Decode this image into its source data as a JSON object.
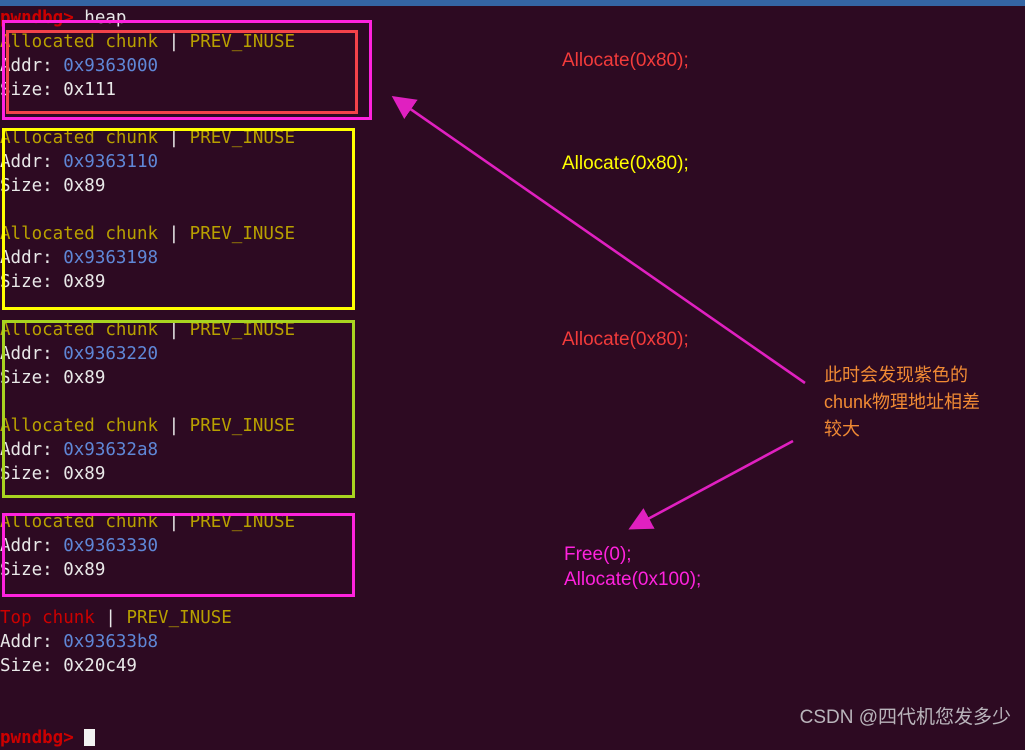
{
  "window": {
    "background_color": "#2d0a22",
    "titlebar_color": "#3465a4"
  },
  "terminal": {
    "prompt_top": "pwndbg>",
    "command_top": " heap",
    "prompt_bottom": "pwndbg>",
    "labels": {
      "allocated_chunk": "Allocated chunk",
      "top_chunk": "Top chunk",
      "separator": " | ",
      "prev_inuse": "PREV_INUSE",
      "addr_label": "Addr: ",
      "size_label": "Size: "
    },
    "chunks": [
      {
        "kind": "Allocated chunk",
        "flags": "PREV_INUSE",
        "addr": "0x9363000",
        "size": "0x111"
      },
      {
        "kind": "Allocated chunk",
        "flags": "PREV_INUSE",
        "addr": "0x9363110",
        "size": "0x89"
      },
      {
        "kind": "Allocated chunk",
        "flags": "PREV_INUSE",
        "addr": "0x9363198",
        "size": "0x89"
      },
      {
        "kind": "Allocated chunk",
        "flags": "PREV_INUSE",
        "addr": "0x9363220",
        "size": "0x89"
      },
      {
        "kind": "Allocated chunk",
        "flags": "PREV_INUSE",
        "addr": "0x93632a8",
        "size": "0x89"
      },
      {
        "kind": "Allocated chunk",
        "flags": "PREV_INUSE",
        "addr": "0x9363330",
        "size": "0x89"
      },
      {
        "kind": "Top chunk",
        "flags": "PREV_INUSE",
        "addr": "0x93633b8",
        "size": "0x20c49"
      }
    ]
  },
  "highlights": [
    {
      "name": "chunk-group-1-outer",
      "color": "#ff22dd"
    },
    {
      "name": "chunk-group-1-inner",
      "color": "#f4424a"
    },
    {
      "name": "chunk-group-2",
      "color": "#ffff00"
    },
    {
      "name": "chunk-group-3",
      "color": "#a8d420"
    },
    {
      "name": "chunk-group-4",
      "color": "#ff22dd"
    }
  ],
  "annotations": {
    "allocate_1": "Allocate(0x80);",
    "allocate_2": "Allocate(0x80);",
    "allocate_3": "Allocate(0x80);",
    "note_cn": "此时会发现紫色的\nchunk物理地址相差\n较大",
    "free_line": "Free(0);",
    "allocate_big": "Allocate(0x100);",
    "arrow_color": "#e020c0"
  },
  "watermark": "CSDN @四代机您发多少"
}
